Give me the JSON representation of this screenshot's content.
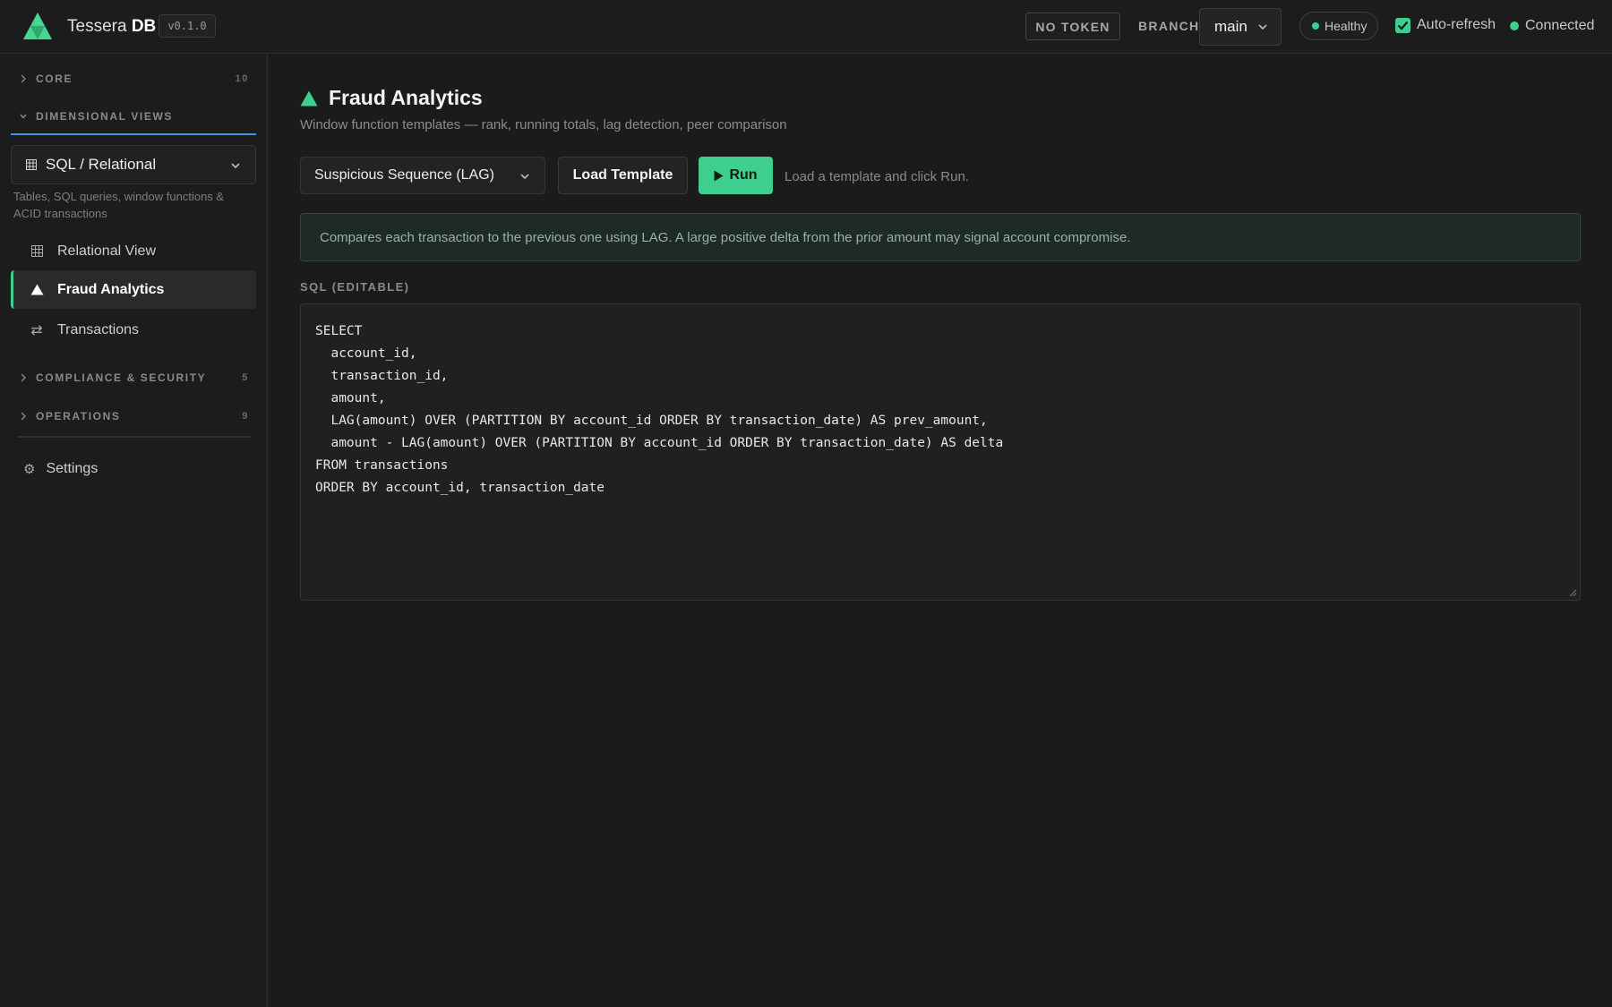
{
  "header": {
    "app_name": "Tessera",
    "app_name_bold": "DB",
    "version": "v0.1.0",
    "token_button": "NO TOKEN",
    "branch_label": "BRANCH",
    "branch_value": "main",
    "health_status": "Healthy",
    "auto_refresh_label": "Auto-refresh",
    "auto_refresh_checked": true,
    "connection_status": "Connected"
  },
  "sidebar": {
    "sections": {
      "core": {
        "label": "CORE",
        "count": "10"
      },
      "dimensional": {
        "label": "DIMENSIONAL VIEWS"
      },
      "compliance": {
        "label": "COMPLIANCE & SECURITY",
        "count": "5"
      },
      "operations": {
        "label": "OPERATIONS",
        "count": "9"
      }
    },
    "view_select": "SQL / Relational",
    "view_description": "Tables, SQL queries, window functions & ACID transactions",
    "items": [
      {
        "label": "Relational View",
        "icon": "table-grid-icon",
        "active": false
      },
      {
        "label": "Fraud Analytics",
        "icon": "triangle-icon",
        "active": true
      },
      {
        "label": "Transactions",
        "icon": "swap-arrows-icon",
        "active": false
      }
    ],
    "settings_label": "Settings"
  },
  "main": {
    "title": "Fraud Analytics",
    "subtitle": "Window function templates — rank, running totals, lag detection, peer comparison",
    "template_select": "Suspicious Sequence (LAG)",
    "load_button": "Load Template",
    "run_button": "Run",
    "run_hint": "Load a template and click Run.",
    "info_text": "Compares each transaction to the previous one using LAG. A large positive delta from the prior amount may signal account compromise.",
    "sql_label": "SQL (EDITABLE)",
    "sql_text": "SELECT\n  account_id,\n  transaction_id,\n  amount,\n  LAG(amount) OVER (PARTITION BY account_id ORDER BY transaction_date) AS prev_amount,\n  amount - LAG(amount) OVER (PARTITION BY account_id ORDER BY transaction_date) AS delta\nFROM transactions\nORDER BY account_id, transaction_date"
  },
  "colors": {
    "accent": "#3ecf8e",
    "selection_underline": "#4a8fe0",
    "background": "#1b1b1b"
  }
}
